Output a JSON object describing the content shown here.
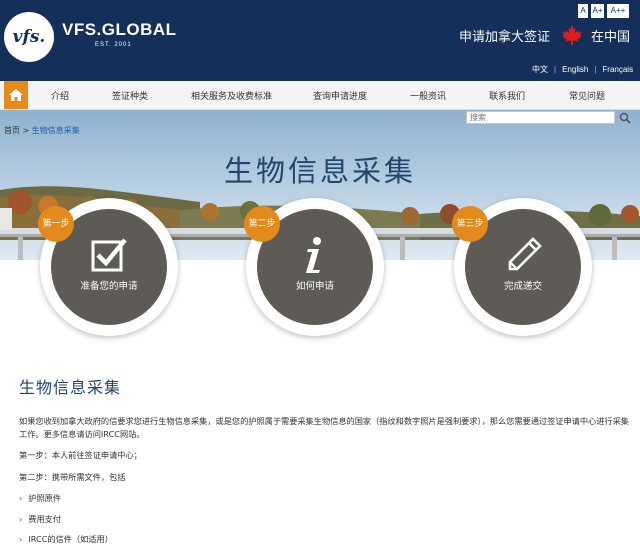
{
  "header": {
    "logo_text": "vfs.",
    "brand": "VFS.GLOBAL",
    "est": "EST. 2001",
    "font_size_buttons": [
      "A",
      "A+",
      "A++"
    ],
    "apply_text": "申请加拿大签证",
    "in_country": "在中国",
    "languages": [
      "中文",
      "English",
      "Français"
    ]
  },
  "nav": {
    "home_icon": "home-icon",
    "items": [
      "介绍",
      "签证种类",
      "相关服务及收费标准",
      "查询申请进度",
      "一般资讯",
      "联系我们",
      "常见问题"
    ]
  },
  "breadcrumb": {
    "home": "首页",
    "separator": " > ",
    "current": "生物信息采集"
  },
  "search": {
    "placeholder": "搜索"
  },
  "hero": {
    "title": "生物信息采集",
    "steps": [
      {
        "badge": "第一步",
        "label": "准备您的申请",
        "icon": "checkbox-icon"
      },
      {
        "badge": "第二步",
        "label": "如何申请",
        "icon": "info-icon"
      },
      {
        "badge": "第三步",
        "label": "完成递交",
        "icon": "pencil-icon"
      }
    ]
  },
  "content": {
    "heading": "生物信息采集",
    "paragraph": "如果您收到加拿大政府的信要求您进行生物信息采集，或是您的护照属于需要采集生物信息的国家（指纹和数字照片是强制要求），那么您需要通过签证申请中心进行采集工作。更多信息请访问IRCC网站。",
    "step1": "第一步：本人前往签证申请中心；",
    "step2": "第二步：携带所需文件，包括",
    "items": [
      "护照原件",
      "费用支付",
      "IRCC的信件（如适用）"
    ]
  },
  "colors": {
    "header_bg": "#14305a",
    "accent_orange": "#e28a1a",
    "title_blue": "#23456e",
    "circle_gray": "#5e5a56"
  }
}
